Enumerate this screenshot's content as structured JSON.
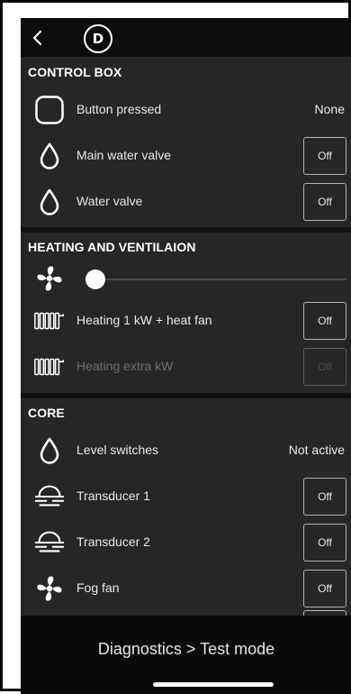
{
  "control_box": {
    "title": "CONTROL BOX",
    "button_pressed": {
      "label": "Button pressed",
      "value": "None"
    },
    "main_water_valve": {
      "label": "Main water valve",
      "toggle": "Off"
    },
    "water_valve": {
      "label": "Water valve",
      "toggle": "Off"
    }
  },
  "heating_ventilation": {
    "title": "HEATING AND VENTILAION",
    "fan_level": 0,
    "heating_1kw": {
      "label": "Heating 1 kW + heat fan",
      "toggle": "Off"
    },
    "heating_extra": {
      "label": "Heating extra kW",
      "toggle": "Off"
    }
  },
  "core": {
    "title": "CORE",
    "level_switches": {
      "label": "Level switches",
      "value": "Not active"
    },
    "transducer_1": {
      "label": "Transducer 1",
      "toggle": "Off"
    },
    "transducer_2": {
      "label": "Transducer 2",
      "toggle": "Off"
    },
    "fog_fan": {
      "label": "Fog fan",
      "toggle": "Off"
    }
  },
  "bottom": {
    "title": "Diagnostics > Test mode"
  },
  "logo": {
    "letter": "D"
  },
  "colors": {
    "background": "#262626",
    "bar": "#0d0d0d",
    "text": "#f2f2f2",
    "disabled": "#4a4a4a"
  }
}
